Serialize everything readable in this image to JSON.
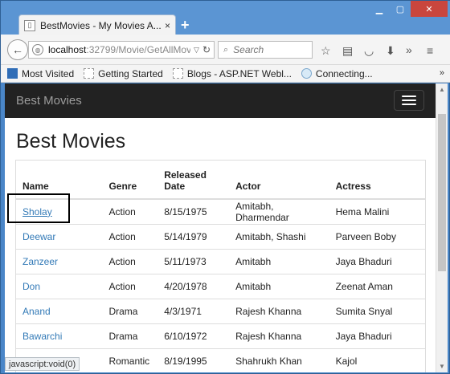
{
  "browser": {
    "tab_title": "BestMovies - My Movies A...",
    "tab_close": "×",
    "new_tab": "+",
    "url_host": "localhost",
    "url_path": ":32799/Movie/GetAllMov",
    "search_placeholder": "Search",
    "bookmarks": [
      "Most Visited",
      "Getting Started",
      "Blogs - ASP.NET Webl...",
      "Connecting..."
    ],
    "status_text": "javascript:void(0)"
  },
  "app": {
    "brand": "Best Movies",
    "page_title": "Best Movies"
  },
  "table": {
    "headers": [
      "Name",
      "Genre",
      "Released Date",
      "Actor",
      "Actress"
    ],
    "rows": [
      [
        "Sholay",
        "Action",
        "8/15/1975",
        "Amitabh, Dharmendar",
        "Hema Malini"
      ],
      [
        "Deewar",
        "Action",
        "5/14/1979",
        "Amitabh, Shashi",
        "Parveen Boby"
      ],
      [
        "Zanzeer",
        "Action",
        "5/11/1973",
        "Amitabh",
        "Jaya Bhaduri"
      ],
      [
        "Don",
        "Action",
        "4/20/1978",
        "Amitabh",
        "Zeenat Aman"
      ],
      [
        "Anand",
        "Drama",
        "4/3/1971",
        "Rajesh Khanna",
        "Sumita Snyal"
      ],
      [
        "Bawarchi",
        "Drama",
        "6/10/1972",
        "Rajesh Khanna",
        "Jaya Bhaduri"
      ],
      [
        "",
        "Romantic",
        "8/19/1995",
        "Shahrukh Khan",
        "Kajol"
      ]
    ]
  },
  "colors": {
    "link": "#337ab7",
    "navbar": "#222222",
    "window_frame": "#4a86c8"
  }
}
